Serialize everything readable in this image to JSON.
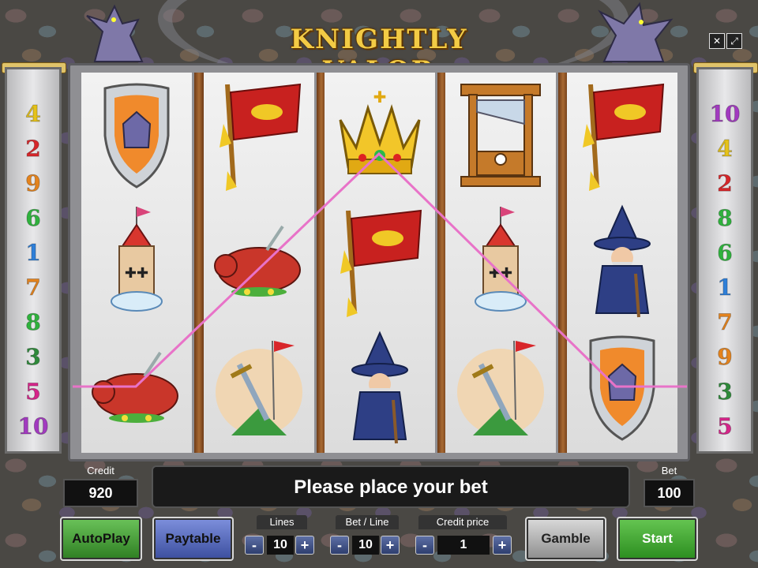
{
  "game": {
    "title": "KNIGHTLY VALOR"
  },
  "colors": {
    "payline": "#e873c8",
    "start_green": "#3a9a2b",
    "paytable_blue": "#4f63b3"
  },
  "left_line_numbers": [
    {
      "label": "4",
      "color": "#e5c21a"
    },
    {
      "label": "2",
      "color": "#d7262a"
    },
    {
      "label": "9",
      "color": "#e4831d"
    },
    {
      "label": "6",
      "color": "#2fb23d"
    },
    {
      "label": "1",
      "color": "#2f7fd8"
    },
    {
      "label": "7",
      "color": "#e4831d"
    },
    {
      "label": "8",
      "color": "#2fb23d"
    },
    {
      "label": "3",
      "color": "#2e8a3a"
    },
    {
      "label": "5",
      "color": "#d6258a"
    },
    {
      "label": "10",
      "color": "#a23ac0"
    }
  ],
  "right_line_numbers": [
    {
      "label": "10",
      "color": "#a23ac0"
    },
    {
      "label": "4",
      "color": "#e5c21a"
    },
    {
      "label": "2",
      "color": "#d7262a"
    },
    {
      "label": "8",
      "color": "#2fb23d"
    },
    {
      "label": "6",
      "color": "#2fb23d"
    },
    {
      "label": "1",
      "color": "#2f7fd8"
    },
    {
      "label": "7",
      "color": "#e4831d"
    },
    {
      "label": "9",
      "color": "#e4831d"
    },
    {
      "label": "3",
      "color": "#2e8a3a"
    },
    {
      "label": "5",
      "color": "#d6258a"
    }
  ],
  "reels": [
    [
      "shield",
      "tower",
      "pig"
    ],
    [
      "flag",
      "pig",
      "sword"
    ],
    [
      "crown",
      "flag",
      "wizard"
    ],
    [
      "guillotine",
      "tower",
      "sword"
    ],
    [
      "flag",
      "wizard",
      "shield"
    ]
  ],
  "status": {
    "message": "Please place your bet"
  },
  "credit": {
    "label": "Credit",
    "value": "920"
  },
  "bet": {
    "label": "Bet",
    "value": "100"
  },
  "buttons": {
    "autoplay": "AutoPlay",
    "paytable": "Paytable",
    "gamble": "Gamble",
    "start": "Start"
  },
  "lines": {
    "label": "Lines",
    "value": "10",
    "minus": "-",
    "plus": "+"
  },
  "bet_line": {
    "label": "Bet / Line",
    "value": "10",
    "minus": "-",
    "plus": "+"
  },
  "credit_price": {
    "label": "Credit price",
    "value": "1",
    "minus": "-",
    "plus": "+"
  },
  "icons": {
    "sound": "mute-icon",
    "fullscreen": "fullscreen-icon"
  }
}
